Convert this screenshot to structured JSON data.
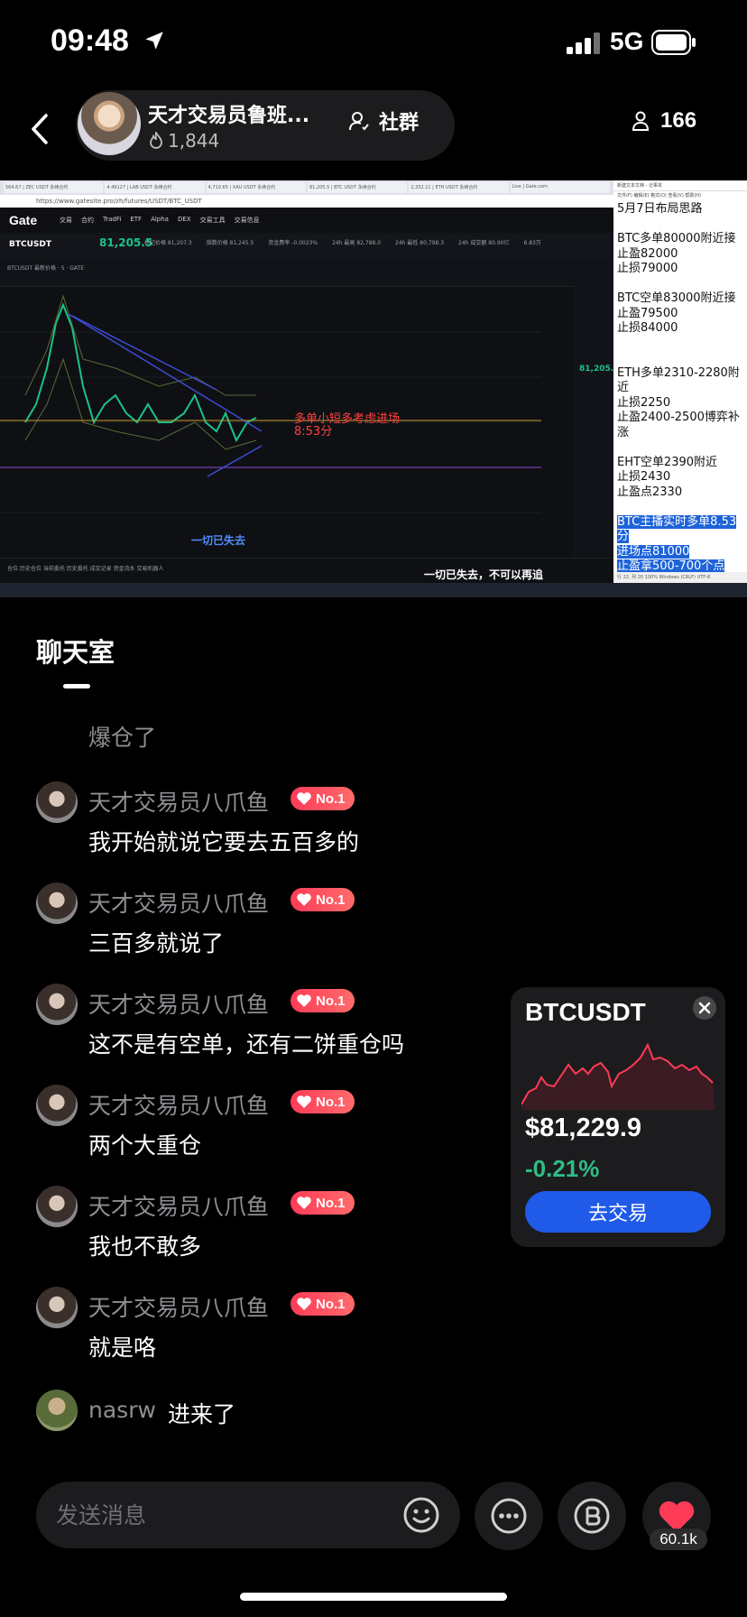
{
  "status": {
    "time": "09:48",
    "network": "5G"
  },
  "header": {
    "host_name": "天才交易员鲁班...",
    "host_likes": "1,844",
    "community_label": "社群",
    "viewers": "166"
  },
  "stream": {
    "browser_tabs": [
      "564.67 | ZEC USDT 永续合约",
      "4.49127 | LAB USDT 永续合约",
      "4,710.65 | XAU USDT 永续合约",
      "81,205.5 | BTC USDT 永续合约",
      "2,332.11 | ETH USDT 永续合约",
      "Live | Gate.com"
    ],
    "url": "https://www.gatesite.pro/zh/futures/USDT/BTC_USDT",
    "gate_logo": "Gate",
    "gate_menu": [
      "交易",
      "合约",
      "TradFi",
      "ETF",
      "Alpha",
      "DEX",
      "交易工具",
      "交易信息"
    ],
    "symbol": "BTCUSDT",
    "price": "81,205.5",
    "stats": [
      "标记价格 81,207.3",
      "指数价格 81,245.5",
      "资金费率 -0.0023%",
      "24h 最高 82,788.0",
      "24h 最低 80,798.3",
      "24h 成交额 80.90亿",
      "6.83万"
    ],
    "toolbar_text": "BTCUSDT 最新价格 · 5 · GATE",
    "annotation_line1": "多单小短多考虑进场",
    "annotation_line2": "8:53分",
    "annotation_loss": "一切已失去",
    "subtitle": "一切已失去，不可以再追",
    "bottom_strip": "仓位  历史仓位  当前委托  历史委托  成交记录  资金流水  交易机器人",
    "orderbook_price": "81,205.5",
    "notepad": {
      "title": "新建文本文档 - 记事本",
      "menu": "文件(F) 编辑(E) 格式(O) 查看(V) 帮助(H)",
      "lines_a": [
        "5月7日布局思路",
        "",
        "BTC多单80000附近接",
        "止盈82000",
        "止损79000",
        "",
        "BTC空单83000附近接",
        "止盈79500",
        "止损84000",
        "",
        "",
        "ETH多单2310-2280附近",
        "止损2250",
        "止盈2400-2500博弈补涨",
        "",
        "EHT空单2390附近",
        "止损2430",
        "止盈点2330",
        ""
      ],
      "lines_hl": [
        "BTC主播实时多单8.53分",
        "进场点81000",
        "止盈拿500-700个点"
      ],
      "status": "行 22, 列 20  100%  Windows (CRLF)  UTF-8"
    }
  },
  "chat": {
    "title": "聊天室",
    "first_message": "爆仓了",
    "messages": [
      {
        "user": "天才交易员八爪鱼",
        "badge": "No.1",
        "text": "我开始就说它要去五百多的"
      },
      {
        "user": "天才交易员八爪鱼",
        "badge": "No.1",
        "text": "三百多就说了"
      },
      {
        "user": "天才交易员八爪鱼",
        "badge": "No.1",
        "text": "这不是有空单，还有二饼重仓吗"
      },
      {
        "user": "天才交易员八爪鱼",
        "badge": "No.1",
        "text": "两个大重仓"
      },
      {
        "user": "天才交易员八爪鱼",
        "badge": "No.1",
        "text": "我也不敢多"
      },
      {
        "user": "天才交易员八爪鱼",
        "badge": "No.1",
        "text": "就是咯"
      }
    ],
    "join": {
      "user": "nasrw",
      "text": "进来了"
    }
  },
  "btc_card": {
    "symbol": "BTCUSDT",
    "price": "$81,229.9",
    "change": "-0.21%",
    "trade_label": "去交易",
    "accent_down": "#ff3b57",
    "accent_up": "#2ebd85"
  },
  "input": {
    "placeholder": "发送消息"
  },
  "likes": "60.1k",
  "icons": [
    "location-arrow-icon",
    "signal-icon",
    "battery-icon",
    "back-arrow-icon",
    "flame-icon",
    "community-icon",
    "person-icon",
    "heart-badge-icon",
    "close-icon",
    "emoji-icon",
    "more-icon",
    "b-coin-icon",
    "heart-icon"
  ]
}
